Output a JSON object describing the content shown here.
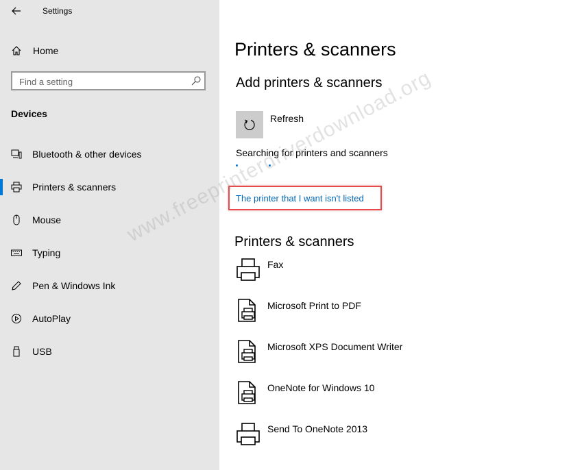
{
  "window": {
    "title": "Settings"
  },
  "sidebar": {
    "home_label": "Home",
    "search_placeholder": "Find a setting",
    "section_title": "Devices",
    "items": [
      {
        "label": "Bluetooth & other devices",
        "icon": "bluetooth-devices-icon"
      },
      {
        "label": "Printers & scanners",
        "icon": "printer-icon",
        "active": true
      },
      {
        "label": "Mouse",
        "icon": "mouse-icon"
      },
      {
        "label": "Typing",
        "icon": "keyboard-icon"
      },
      {
        "label": "Pen & Windows Ink",
        "icon": "pen-icon"
      },
      {
        "label": "AutoPlay",
        "icon": "autoplay-icon"
      },
      {
        "label": "USB",
        "icon": "usb-icon"
      }
    ]
  },
  "main": {
    "page_title": "Printers & scanners",
    "add_section_title": "Add printers & scanners",
    "refresh_label": "Refresh",
    "searching_text": "Searching for printers and scanners",
    "not_listed_link": "The printer that I want isn't listed",
    "list_title": "Printers & scanners",
    "devices": [
      {
        "name": "Fax",
        "icon": "printer-icon"
      },
      {
        "name": "Microsoft Print to PDF",
        "icon": "file-printer-icon"
      },
      {
        "name": "Microsoft XPS Document Writer",
        "icon": "file-printer-icon"
      },
      {
        "name": "OneNote for Windows 10",
        "icon": "file-printer-icon"
      },
      {
        "name": "Send To OneNote 2013",
        "icon": "printer-icon"
      }
    ]
  },
  "watermark": "www.freeprinterdriverdownload.org",
  "colors": {
    "accent": "#0078d7",
    "link": "#0067b8",
    "highlight_box": "#e64a4a",
    "sidebar_bg": "#e6e6e6"
  }
}
